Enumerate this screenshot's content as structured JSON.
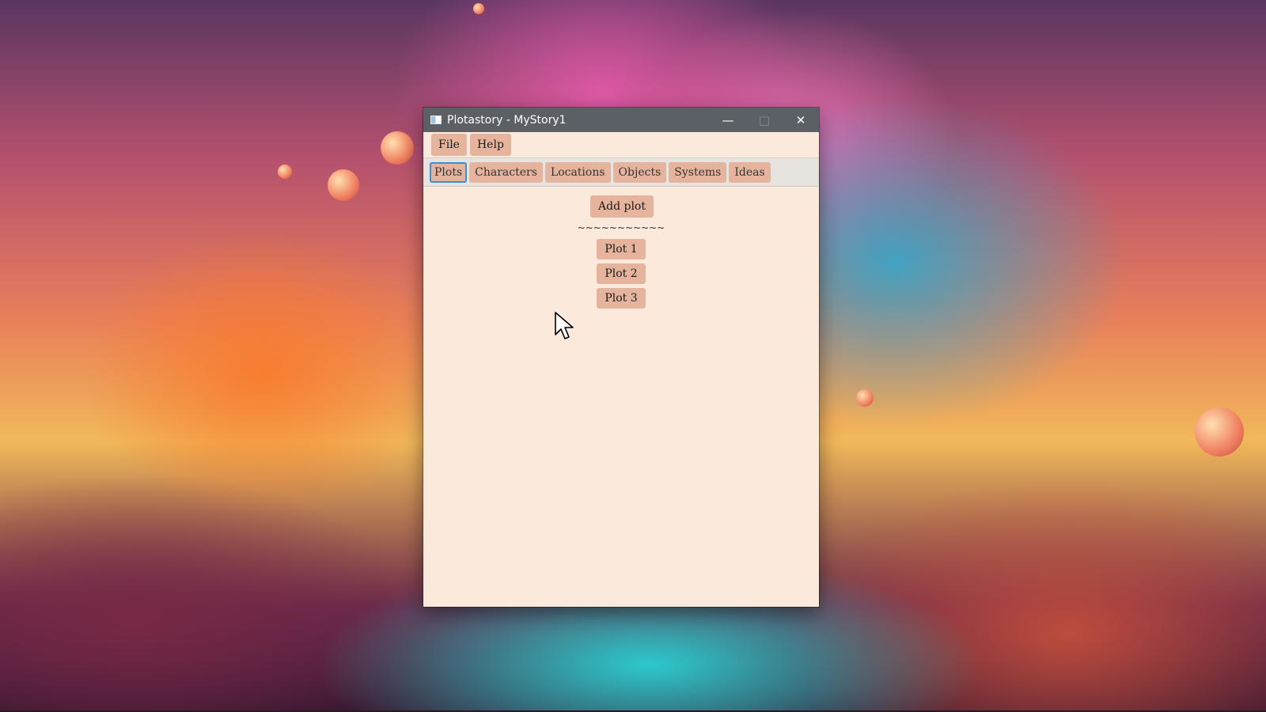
{
  "window": {
    "title": "Plotastory - MyStory1",
    "controls": {
      "minimize": "—",
      "maximize": "□",
      "close": "✕"
    }
  },
  "menu": {
    "items": [
      "File",
      "Help"
    ]
  },
  "tabs": {
    "items": [
      "Plots",
      "Characters",
      "Locations",
      "Objects",
      "Systems",
      "Ideas"
    ],
    "active": "Plots"
  },
  "plots_panel": {
    "add_label": "Add plot",
    "separator": "~~~~~~~~~~~",
    "plots": [
      "Plot 1",
      "Plot 2",
      "Plot 3"
    ]
  },
  "colors": {
    "button_bg": "#e6b49d",
    "window_bg": "#fbeadb",
    "titlebar_bg": "#5c5f63",
    "tab_focus": "#3d8fd1"
  },
  "icons": {
    "app": "window-icon",
    "cursor": "mouse-pointer-icon"
  }
}
